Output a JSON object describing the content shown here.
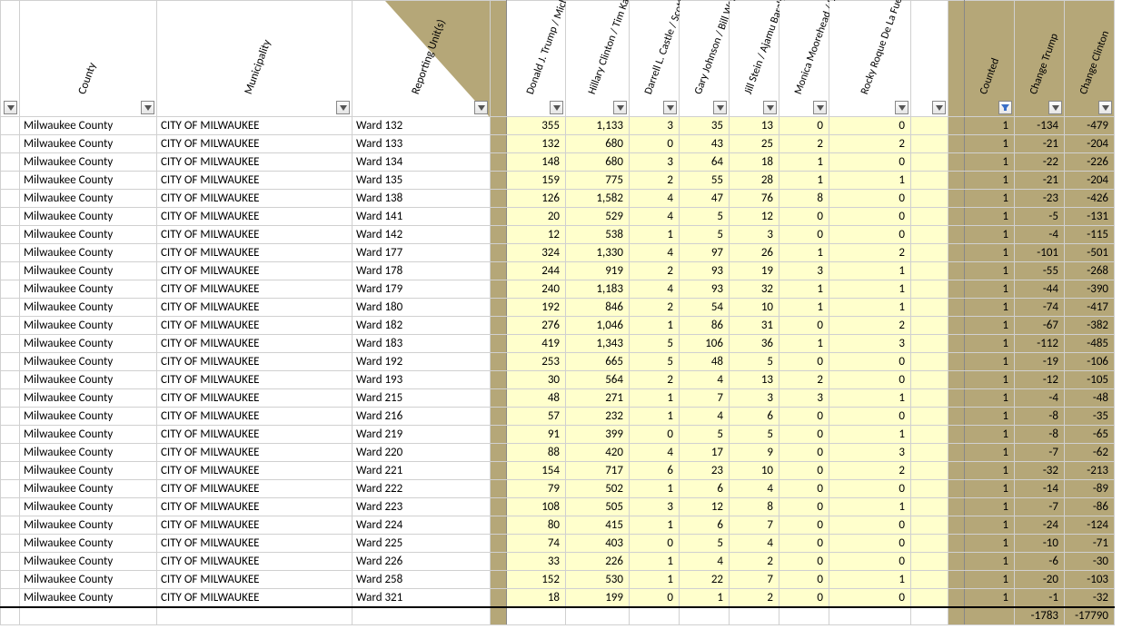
{
  "headers": {
    "county": "County",
    "municipality": "Municipality",
    "reportingUnit": "Reporting Unit(s)",
    "cands": [
      "Donald J. Trump / Michael R. Pence",
      "Hillary Clinton / Tim Kaine",
      "Darrell L. Castle / Scott N. Bradley",
      "Gary Johnson / Bill Weld",
      "Jill Stein / Ajamu Baraka",
      "Monica Moorehead /   Lamont Lilly",
      "Rocky Roque De La Fuente / Michael Steinberg"
    ],
    "summary": [
      "Counted",
      "Change Trump",
      "Change Clinton"
    ]
  },
  "rows": [
    {
      "county": "Milwaukee County",
      "muni": "CITY OF MILWAUKEE",
      "unit": "Ward 132",
      "d": [
        "355",
        "1,133",
        "3",
        "35",
        "13",
        "0",
        "0"
      ],
      "s": [
        "1",
        "-134",
        "-479"
      ]
    },
    {
      "county": "Milwaukee County",
      "muni": "CITY OF MILWAUKEE",
      "unit": "Ward 133",
      "d": [
        "132",
        "680",
        "0",
        "43",
        "25",
        "2",
        "2"
      ],
      "s": [
        "1",
        "-21",
        "-204"
      ]
    },
    {
      "county": "Milwaukee County",
      "muni": "CITY OF MILWAUKEE",
      "unit": "Ward 134",
      "d": [
        "148",
        "680",
        "3",
        "64",
        "18",
        "1",
        "0"
      ],
      "s": [
        "1",
        "-22",
        "-226"
      ]
    },
    {
      "county": "Milwaukee County",
      "muni": "CITY OF MILWAUKEE",
      "unit": "Ward 135",
      "d": [
        "159",
        "775",
        "2",
        "55",
        "28",
        "1",
        "1"
      ],
      "s": [
        "1",
        "-21",
        "-204"
      ]
    },
    {
      "county": "Milwaukee County",
      "muni": "CITY OF MILWAUKEE",
      "unit": "Ward 138",
      "d": [
        "126",
        "1,582",
        "4",
        "47",
        "76",
        "8",
        "0"
      ],
      "s": [
        "1",
        "-23",
        "-426"
      ]
    },
    {
      "county": "Milwaukee County",
      "muni": "CITY OF MILWAUKEE",
      "unit": "Ward 141",
      "d": [
        "20",
        "529",
        "4",
        "5",
        "12",
        "0",
        "0"
      ],
      "s": [
        "1",
        "-5",
        "-131"
      ]
    },
    {
      "county": "Milwaukee County",
      "muni": "CITY OF MILWAUKEE",
      "unit": "Ward 142",
      "d": [
        "12",
        "538",
        "1",
        "5",
        "3",
        "0",
        "0"
      ],
      "s": [
        "1",
        "-4",
        "-115"
      ]
    },
    {
      "county": "Milwaukee County",
      "muni": "CITY OF MILWAUKEE",
      "unit": "Ward 177",
      "d": [
        "324",
        "1,330",
        "4",
        "97",
        "26",
        "1",
        "2"
      ],
      "s": [
        "1",
        "-101",
        "-501"
      ]
    },
    {
      "county": "Milwaukee County",
      "muni": "CITY OF MILWAUKEE",
      "unit": "Ward 178",
      "d": [
        "244",
        "919",
        "2",
        "93",
        "19",
        "3",
        "1"
      ],
      "s": [
        "1",
        "-55",
        "-268"
      ]
    },
    {
      "county": "Milwaukee County",
      "muni": "CITY OF MILWAUKEE",
      "unit": "Ward 179",
      "d": [
        "240",
        "1,183",
        "4",
        "93",
        "32",
        "1",
        "1"
      ],
      "s": [
        "1",
        "-44",
        "-390"
      ]
    },
    {
      "county": "Milwaukee County",
      "muni": "CITY OF MILWAUKEE",
      "unit": "Ward 180",
      "d": [
        "192",
        "846",
        "2",
        "54",
        "10",
        "1",
        "1"
      ],
      "s": [
        "1",
        "-74",
        "-417"
      ]
    },
    {
      "county": "Milwaukee County",
      "muni": "CITY OF MILWAUKEE",
      "unit": "Ward 182",
      "d": [
        "276",
        "1,046",
        "1",
        "86",
        "31",
        "0",
        "2"
      ],
      "s": [
        "1",
        "-67",
        "-382"
      ]
    },
    {
      "county": "Milwaukee County",
      "muni": "CITY OF MILWAUKEE",
      "unit": "Ward 183",
      "d": [
        "419",
        "1,343",
        "5",
        "106",
        "36",
        "1",
        "3"
      ],
      "s": [
        "1",
        "-112",
        "-485"
      ]
    },
    {
      "county": "Milwaukee County",
      "muni": "CITY OF MILWAUKEE",
      "unit": "Ward 192",
      "d": [
        "253",
        "665",
        "5",
        "48",
        "5",
        "0",
        "0"
      ],
      "s": [
        "1",
        "-19",
        "-106"
      ]
    },
    {
      "county": "Milwaukee County",
      "muni": "CITY OF MILWAUKEE",
      "unit": "Ward 193",
      "d": [
        "30",
        "564",
        "2",
        "4",
        "13",
        "2",
        "0"
      ],
      "s": [
        "1",
        "-12",
        "-105"
      ]
    },
    {
      "county": "Milwaukee County",
      "muni": "CITY OF MILWAUKEE",
      "unit": "Ward 215",
      "d": [
        "48",
        "271",
        "1",
        "7",
        "3",
        "3",
        "1"
      ],
      "s": [
        "1",
        "-4",
        "-48"
      ]
    },
    {
      "county": "Milwaukee County",
      "muni": "CITY OF MILWAUKEE",
      "unit": "Ward 216",
      "d": [
        "57",
        "232",
        "1",
        "4",
        "6",
        "0",
        "0"
      ],
      "s": [
        "1",
        "-8",
        "-35"
      ]
    },
    {
      "county": "Milwaukee County",
      "muni": "CITY OF MILWAUKEE",
      "unit": "Ward 219",
      "d": [
        "91",
        "399",
        "0",
        "5",
        "5",
        "0",
        "1"
      ],
      "s": [
        "1",
        "-8",
        "-65"
      ]
    },
    {
      "county": "Milwaukee County",
      "muni": "CITY OF MILWAUKEE",
      "unit": "Ward 220",
      "d": [
        "88",
        "420",
        "4",
        "17",
        "9",
        "0",
        "3"
      ],
      "s": [
        "1",
        "-7",
        "-62"
      ]
    },
    {
      "county": "Milwaukee County",
      "muni": "CITY OF MILWAUKEE",
      "unit": "Ward 221",
      "d": [
        "154",
        "717",
        "6",
        "23",
        "10",
        "0",
        "2"
      ],
      "s": [
        "1",
        "-32",
        "-213"
      ]
    },
    {
      "county": "Milwaukee County",
      "muni": "CITY OF MILWAUKEE",
      "unit": "Ward 222",
      "d": [
        "79",
        "502",
        "1",
        "6",
        "4",
        "0",
        "0"
      ],
      "s": [
        "1",
        "-14",
        "-89"
      ]
    },
    {
      "county": "Milwaukee County",
      "muni": "CITY OF MILWAUKEE",
      "unit": "Ward 223",
      "d": [
        "108",
        "505",
        "3",
        "12",
        "8",
        "0",
        "1"
      ],
      "s": [
        "1",
        "-7",
        "-86"
      ]
    },
    {
      "county": "Milwaukee County",
      "muni": "CITY OF MILWAUKEE",
      "unit": "Ward 224",
      "d": [
        "80",
        "415",
        "1",
        "6",
        "7",
        "0",
        "0"
      ],
      "s": [
        "1",
        "-24",
        "-124"
      ]
    },
    {
      "county": "Milwaukee County",
      "muni": "CITY OF MILWAUKEE",
      "unit": "Ward 225",
      "d": [
        "74",
        "403",
        "0",
        "5",
        "4",
        "0",
        "0"
      ],
      "s": [
        "1",
        "-10",
        "-71"
      ]
    },
    {
      "county": "Milwaukee County",
      "muni": "CITY OF MILWAUKEE",
      "unit": "Ward 226",
      "d": [
        "33",
        "226",
        "1",
        "4",
        "2",
        "0",
        "0"
      ],
      "s": [
        "1",
        "-6",
        "-30"
      ]
    },
    {
      "county": "Milwaukee County",
      "muni": "CITY OF MILWAUKEE",
      "unit": "Ward 258",
      "d": [
        "152",
        "530",
        "1",
        "22",
        "7",
        "0",
        "1"
      ],
      "s": [
        "1",
        "-20",
        "-103"
      ]
    },
    {
      "county": "Milwaukee County",
      "muni": "CITY OF MILWAUKEE",
      "unit": "Ward 321",
      "d": [
        "18",
        "199",
        "0",
        "1",
        "2",
        "0",
        "0"
      ],
      "s": [
        "1",
        "-1",
        "-32"
      ]
    }
  ],
  "footer": {
    "changeTrump": "-1783",
    "changeClinton": "-17790"
  }
}
